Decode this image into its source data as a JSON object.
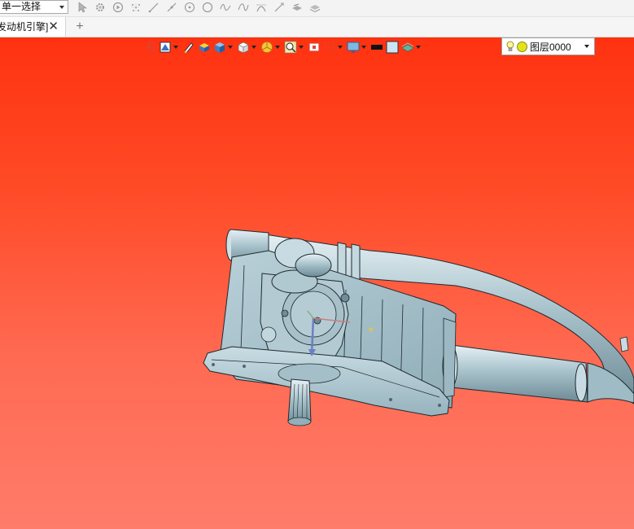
{
  "selection_filter": {
    "value": "单一选择"
  },
  "snap_toolbar": {
    "icons": [
      "select-arrow-icon",
      "gear-filter-icon",
      "play-circle-icon",
      "point-cloud-icon",
      "line-snap-icon",
      "endpoint-snap-icon",
      "center-snap-icon",
      "circle-snap-icon",
      "curve-snap-icon",
      "spline-snap-icon",
      "arc-snap-icon",
      "tangent-snap-icon",
      "layer-hide-icon",
      "layer-stack-icon"
    ]
  },
  "tabs": {
    "active": {
      "label": "发动机引擎]",
      "close": "✕"
    },
    "new_tab": "+"
  },
  "view_toolbar": {
    "icons": [
      "exit-icon",
      "render-mode-icon",
      "pen-icon",
      "shaded-box-icon",
      "solid-cube-icon",
      "white-cube-icon",
      "pie-section-icon",
      "zoom-window-icon",
      "fit-view-icon",
      "clip-plane-icon",
      "monitor-display-icon",
      "black-color-swatch",
      "light-color-swatch",
      "layer-plane-icon"
    ]
  },
  "layer_selector": {
    "label": "图层0000"
  },
  "colors": {
    "viewport_top": "#ff3210",
    "viewport_bottom": "#ff7c6a",
    "model_body": "#a8c4cf",
    "model_edge": "#1e2a30"
  }
}
